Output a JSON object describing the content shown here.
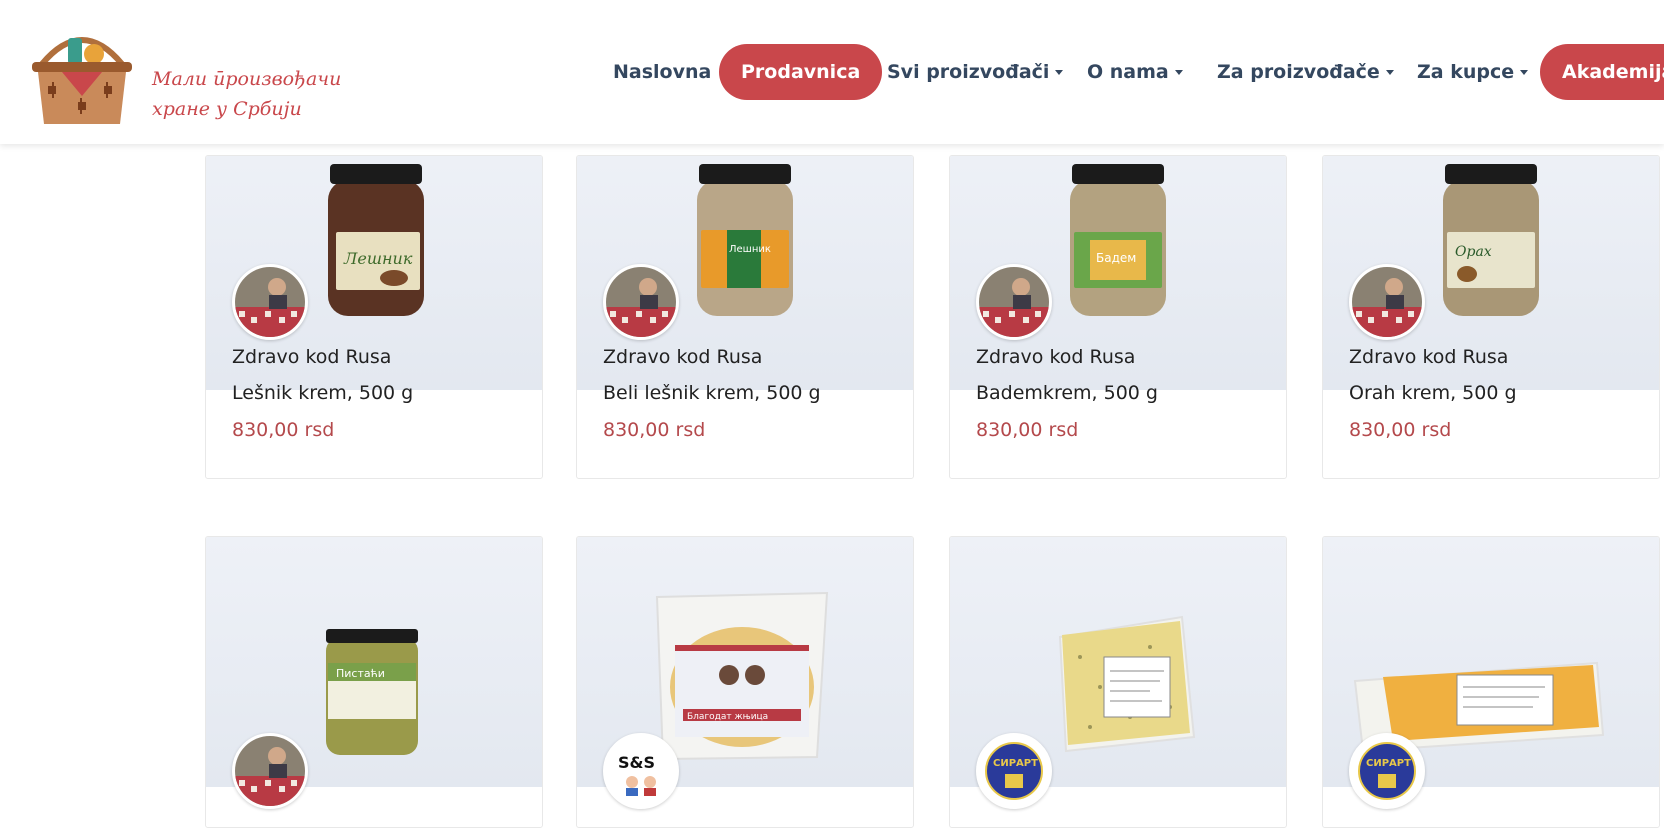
{
  "brand": {
    "line1": "Мали ӣроизвођачи",
    "line2": "хране у Србији"
  },
  "nav": [
    {
      "label": "Naslovna",
      "active": false,
      "dropdown": false
    },
    {
      "label": "Prodavnica",
      "active": true,
      "dropdown": false
    },
    {
      "label": "Svi proizvođači",
      "active": false,
      "dropdown": true
    },
    {
      "label": "O nama",
      "active": false,
      "dropdown": true
    },
    {
      "label": "Za proizvođače",
      "active": false,
      "dropdown": true
    },
    {
      "label": "Za kupce",
      "active": false,
      "dropdown": true
    },
    {
      "label": "Akademija",
      "active": true,
      "dropdown": false
    }
  ],
  "products": [
    {
      "producer": "Zdravo kod Rusa",
      "name": "Lešnik krem, 500 g",
      "price": "830,00 rsd",
      "jar_label": "Лешник",
      "jar_color": "#5a3323"
    },
    {
      "producer": "Zdravo kod Rusa",
      "name": "Beli lešnik krem, 500 g",
      "price": "830,00 rsd",
      "jar_label": "Лешник",
      "jar_color": "#b9a688"
    },
    {
      "producer": "Zdravo kod Rusa",
      "name": "Bademkrem, 500 g",
      "price": "830,00 rsd",
      "jar_label": "Бадем",
      "jar_color": "#b3a280"
    },
    {
      "producer": "Zdravo kod Rusa",
      "name": "Orah krem, 500 g",
      "price": "830,00 rsd",
      "jar_label": "Орах",
      "jar_color": "#a99776"
    }
  ],
  "products_row2": [
    {
      "jar_label": "Пистаћи",
      "badge": "zdravo"
    },
    {
      "badge": "S&S",
      "package_label": "Благодат жњица"
    },
    {
      "badge": "СИРАРТ"
    },
    {
      "badge": "СИРАРТ"
    }
  ],
  "colors": {
    "accent": "#c9474b",
    "nav_text": "#34475f",
    "price": "#b4494c"
  }
}
